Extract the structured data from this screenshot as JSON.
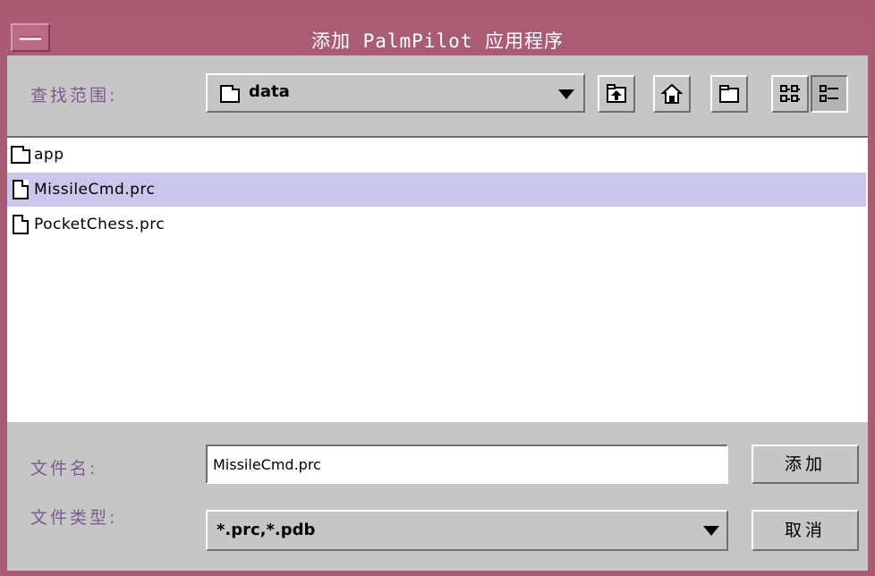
{
  "window": {
    "title": "添加 PalmPilot 应用程序"
  },
  "toolbar": {
    "look_in_label": "查找范围:",
    "look_in_value": "data",
    "buttons": [
      {
        "icon": "up-folder-icon"
      },
      {
        "icon": "home-icon"
      },
      {
        "icon": "new-folder-icon"
      },
      {
        "icon": "list-view-icon"
      },
      {
        "icon": "details-view-icon",
        "selected": true
      }
    ]
  },
  "files": [
    {
      "name": "app",
      "type": "folder",
      "selected": false
    },
    {
      "name": "MissileCmd.prc",
      "type": "file",
      "selected": true
    },
    {
      "name": "PocketChess.prc",
      "type": "file",
      "selected": false
    }
  ],
  "bottom": {
    "filename_label": "文件名:",
    "filename_value": "MissileCmd.prc",
    "filetype_label": "文件类型:",
    "filetype_value": "*.prc,*.pdb",
    "add_button": "添加",
    "cancel_button": "取消"
  },
  "colors": {
    "titlebar": "#aa5c74",
    "panel": "#c6c6c6",
    "selection": "#cbc6ec",
    "label_text": "#7a5c92"
  }
}
